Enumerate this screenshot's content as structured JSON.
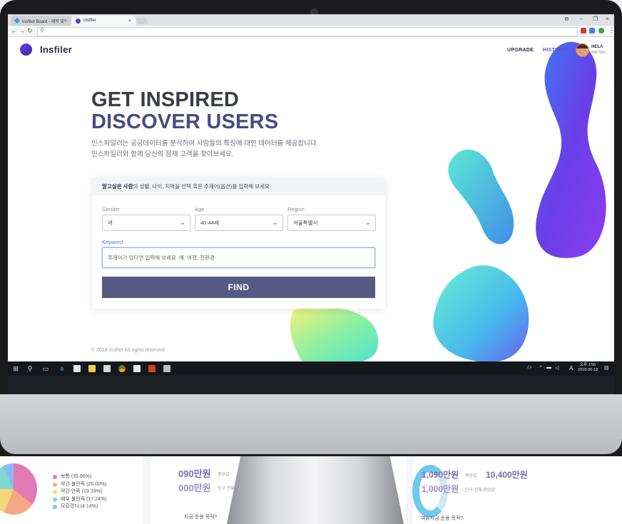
{
  "browser": {
    "tabs": [
      {
        "label": "Insfiler Board - 제작 및 ..."
      },
      {
        "label": "Insfiler"
      }
    ],
    "address": "",
    "close_glyph": "×",
    "window_controls": {
      "account": "⊖",
      "minimize": "–",
      "restore": "❐",
      "close": "×"
    }
  },
  "app": {
    "brand": "Insfiler",
    "nav": {
      "upgrade": "UPGRADE",
      "history": "HISTORY"
    },
    "user": {
      "name": "HELA",
      "subtitle": "WRITER"
    },
    "hero": {
      "line1": "GET INSPIRED",
      "line2": "DISCOVER USERS",
      "desc1": "인스파일러는 공공데이터를 분석하여 사람들의 특징에 대한 데이터를 제공합니다.",
      "desc2": "인스파일러와 함께 당신의 잠재 고객을 찾아보세요."
    },
    "form": {
      "header_bold": "알고싶은 사람",
      "header_rest": "의 성별, 나이, 지역을 선택 혹은 주제어(옵션)를 입력해 보세요.",
      "gender": {
        "label": "Gender",
        "value": "여"
      },
      "age": {
        "label": "Age",
        "value": "40-44세"
      },
      "region": {
        "label": "Region",
        "value": "서울특별시"
      },
      "keyword": {
        "label": "Keyword",
        "placeholder": "주제어가 있다면 입력해 보세요. 예: 여행, 친환경"
      },
      "submit": "FIND"
    },
    "footer": "© 2018 Insfiler All rights reserved",
    "colors": {
      "accent": "#545a82",
      "heading_dark": "#3a3c47",
      "heading_accent": "#474b7f",
      "focus": "#4f6fe6"
    }
  },
  "taskbar": {
    "time": "오후 1:56",
    "date": "2018-06-19",
    "ime": "A"
  },
  "background_dashboard": {
    "legend": [
      {
        "label": "보통 (35.86%)",
        "color": "#e07bb5"
      },
      {
        "label": "약간 불안족 (20.00%)",
        "color": "#f6a882"
      },
      {
        "label": "약간 안족 (19.33%)",
        "color": "#f8d77a"
      },
      {
        "label": "매우 불안족 (17.24%)",
        "color": "#80d8d1"
      },
      {
        "label": "모르겠다 (4.14%)",
        "color": "#8ab8f5"
      }
    ],
    "value1": "090만원",
    "value1_note": "중앙값",
    "value2": "000만원",
    "value2_note": "인구 전체 중앙값",
    "value3": "1,090만원",
    "value3_note": "중앙값",
    "value4": "10,400만원",
    "value5": "1,000만원",
    "value5_note": "인구 전체 중앙값",
    "question_left": "자금 운용 목적?",
    "question_right": "여유자금 운용 목적?"
  }
}
